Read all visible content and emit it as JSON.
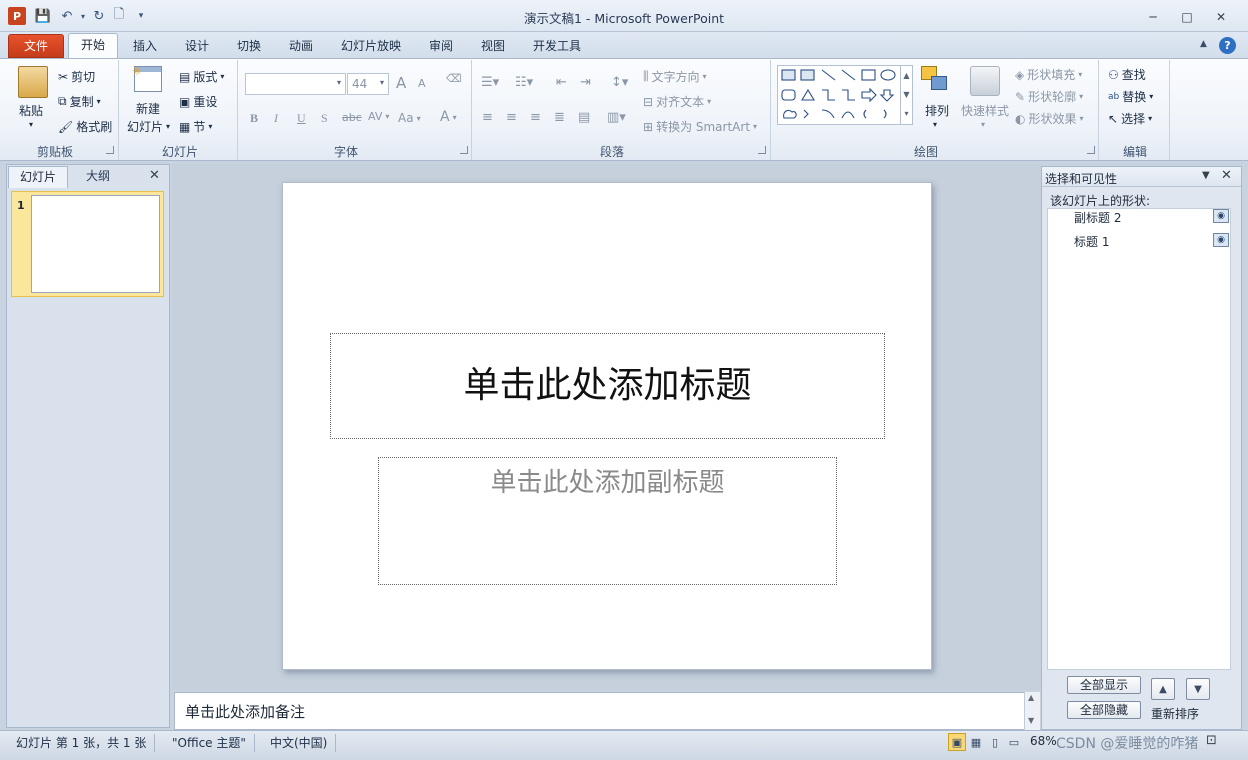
{
  "window": {
    "title": "演示文稿1 - Microsoft PowerPoint",
    "min": "─",
    "max": "□",
    "close": "✕"
  },
  "tabs": {
    "file": "文件",
    "home": "开始",
    "insert": "插入",
    "design": "设计",
    "transitions": "切换",
    "animations": "动画",
    "slideshow": "幻灯片放映",
    "review": "审阅",
    "view": "视图",
    "developer": "开发工具"
  },
  "clipboard": {
    "paste": "粘贴",
    "cut": "剪切",
    "copy": "复制",
    "format_painter": "格式刷",
    "label": "剪贴板"
  },
  "slides_group": {
    "new_slide_line1": "新建",
    "new_slide_line2": "幻灯片",
    "layout": "版式",
    "reset": "重设",
    "section": "节",
    "label": "幻灯片"
  },
  "font": {
    "size": "44",
    "bold": "B",
    "italic": "I",
    "underline": "U",
    "shadow": "S",
    "strike": "abc",
    "spacing": "AV",
    "case": "Aa",
    "color": "A",
    "grow": "A",
    "shrink": "A",
    "label": "字体"
  },
  "paragraph": {
    "text_direction": "文字方向",
    "align_text": "对齐文本",
    "smartart": "转换为 SmartArt",
    "label": "段落"
  },
  "drawing": {
    "arrange": "排列",
    "quick_styles": "快速样式",
    "shape_fill": "形状填充",
    "shape_outline": "形状轮廓",
    "shape_effects": "形状效果",
    "label": "绘图"
  },
  "editing": {
    "find": "查找",
    "replace": "替换",
    "select": "选择",
    "label": "编辑"
  },
  "left_panel": {
    "tab_slides": "幻灯片",
    "tab_outline": "大纲",
    "slide_number": "1"
  },
  "slide": {
    "title_placeholder": "单击此处添加标题",
    "subtitle_placeholder": "单击此处添加副标题"
  },
  "notes": {
    "placeholder": "单击此处添加备注"
  },
  "selection_pane": {
    "title": "选择和可见性",
    "subtitle": "该幻灯片上的形状:",
    "items": [
      "副标题 2",
      "标题 1"
    ],
    "show_all": "全部显示",
    "hide_all": "全部隐藏",
    "reorder": "重新排序"
  },
  "status": {
    "slide_info": "幻灯片 第 1 张，共 1 张",
    "theme": "\"Office 主题\"",
    "language": "中文(中国)",
    "zoom": "68%",
    "watermark": "CSDN @爱睡觉的咋猪"
  },
  "colors": {
    "file_tab": "#d9452a",
    "thumb_highlight": "#fbe79b"
  }
}
